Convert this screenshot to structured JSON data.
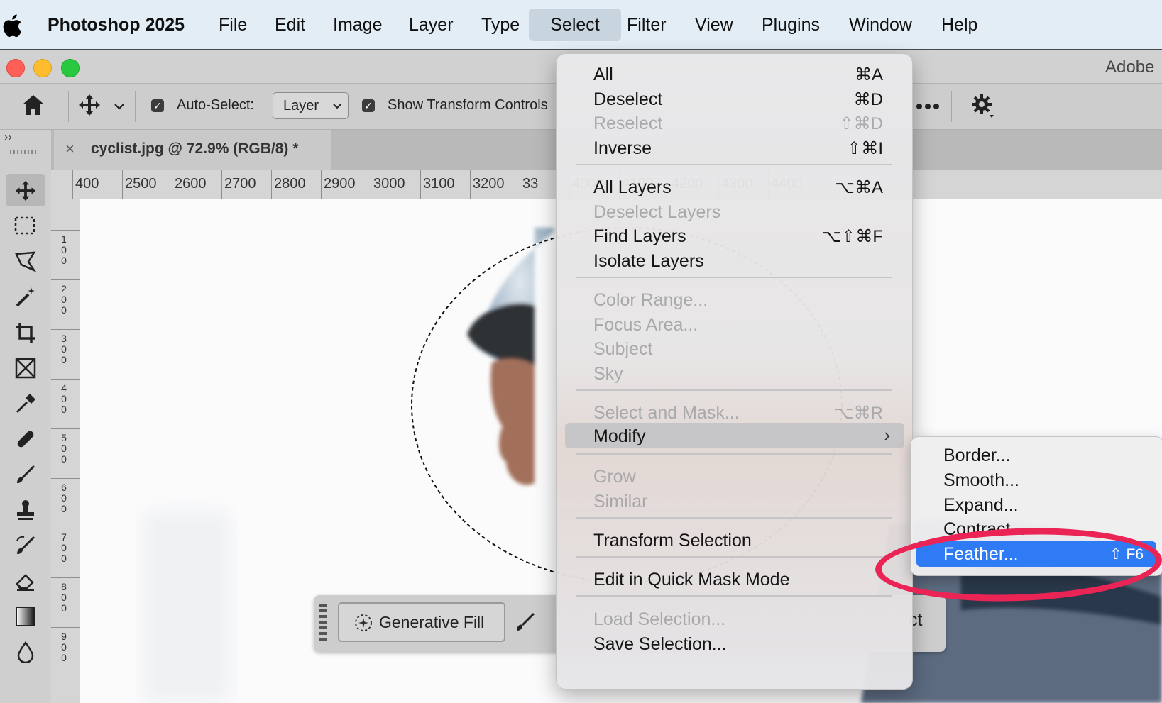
{
  "menubar": {
    "app_name": "Photoshop 2025",
    "items": [
      "File",
      "Edit",
      "Image",
      "Layer",
      "Type",
      "Select",
      "Filter",
      "View",
      "Plugins",
      "Window",
      "Help"
    ],
    "active_item": "Select"
  },
  "window": {
    "app_title_partial": "Adobe",
    "document_tab": "cyclist.jpg @ 72.9% (RGB/8) *",
    "close_glyph": "×"
  },
  "options_bar": {
    "auto_select_label": "Auto-Select:",
    "auto_select_checked": true,
    "auto_select_value": "Layer",
    "show_transform_label": "Show Transform Controls",
    "show_transform_checked": true
  },
  "rulers": {
    "horizontal_labels": [
      "400",
      "2500",
      "2600",
      "2700",
      "2800",
      "2900",
      "3000",
      "3100",
      "3200",
      "33",
      "4000",
      "4100",
      "4200",
      "4300",
      "4400"
    ],
    "vertical_labels": [
      "1 0 0",
      "2 0 0",
      "3 0 0",
      "4 0 0",
      "5 0 0",
      "6 0 0",
      "7 0 0",
      "8 0 0",
      "9 0 0"
    ]
  },
  "context_bar": {
    "generative_fill_label": "Generative Fill",
    "partial_label": "ct"
  },
  "select_menu": {
    "items": [
      {
        "label": "All",
        "shortcut": "⌘A",
        "enabled": true
      },
      {
        "label": "Deselect",
        "shortcut": "⌘D",
        "enabled": true
      },
      {
        "label": "Reselect",
        "shortcut": "⇧⌘D",
        "enabled": false
      },
      {
        "label": "Inverse",
        "shortcut": "⇧⌘I",
        "enabled": true
      },
      {
        "label": "All Layers",
        "shortcut": "⌥⌘A",
        "enabled": true
      },
      {
        "label": "Deselect Layers",
        "shortcut": "",
        "enabled": false
      },
      {
        "label": "Find Layers",
        "shortcut": "⌥⇧⌘F",
        "enabled": true
      },
      {
        "label": "Isolate Layers",
        "shortcut": "",
        "enabled": true
      },
      {
        "label": "Color Range...",
        "shortcut": "",
        "enabled": false
      },
      {
        "label": "Focus Area...",
        "shortcut": "",
        "enabled": false
      },
      {
        "label": "Subject",
        "shortcut": "",
        "enabled": false
      },
      {
        "label": "Sky",
        "shortcut": "",
        "enabled": false
      },
      {
        "label": "Select and Mask...",
        "shortcut": "⌥⌘R",
        "enabled": false
      },
      {
        "label": "Modify",
        "shortcut": "",
        "enabled": true,
        "submenu": true,
        "highlighted": true
      },
      {
        "label": "Grow",
        "shortcut": "",
        "enabled": false
      },
      {
        "label": "Similar",
        "shortcut": "",
        "enabled": false
      },
      {
        "label": "Transform Selection",
        "shortcut": "",
        "enabled": true
      },
      {
        "label": "Edit in Quick Mask Mode",
        "shortcut": "",
        "enabled": true
      },
      {
        "label": "Load Selection...",
        "shortcut": "",
        "enabled": false
      },
      {
        "label": "Save Selection...",
        "shortcut": "",
        "enabled": true
      }
    ],
    "submenu_arrow": "›"
  },
  "modify_submenu": {
    "items": [
      {
        "label": "Border...",
        "shortcut": ""
      },
      {
        "label": "Smooth...",
        "shortcut": ""
      },
      {
        "label": "Expand...",
        "shortcut": ""
      },
      {
        "label": "Contract...",
        "shortcut": ""
      },
      {
        "label": "Feather...",
        "shortcut": "⇧ F6",
        "active": true
      }
    ]
  },
  "colors": {
    "menu_active_blue": "#2f7bf6",
    "annotation_red": "#ea2455",
    "mac_close": "#ff5f57",
    "mac_min": "#febc2e",
    "mac_max": "#28c840"
  },
  "icons": [
    "apple-icon",
    "home-icon",
    "move-icon",
    "chevron-down-icon",
    "checkbox-icon",
    "more-icon",
    "gear-icon",
    "sparkle-icon",
    "brush-icon"
  ]
}
